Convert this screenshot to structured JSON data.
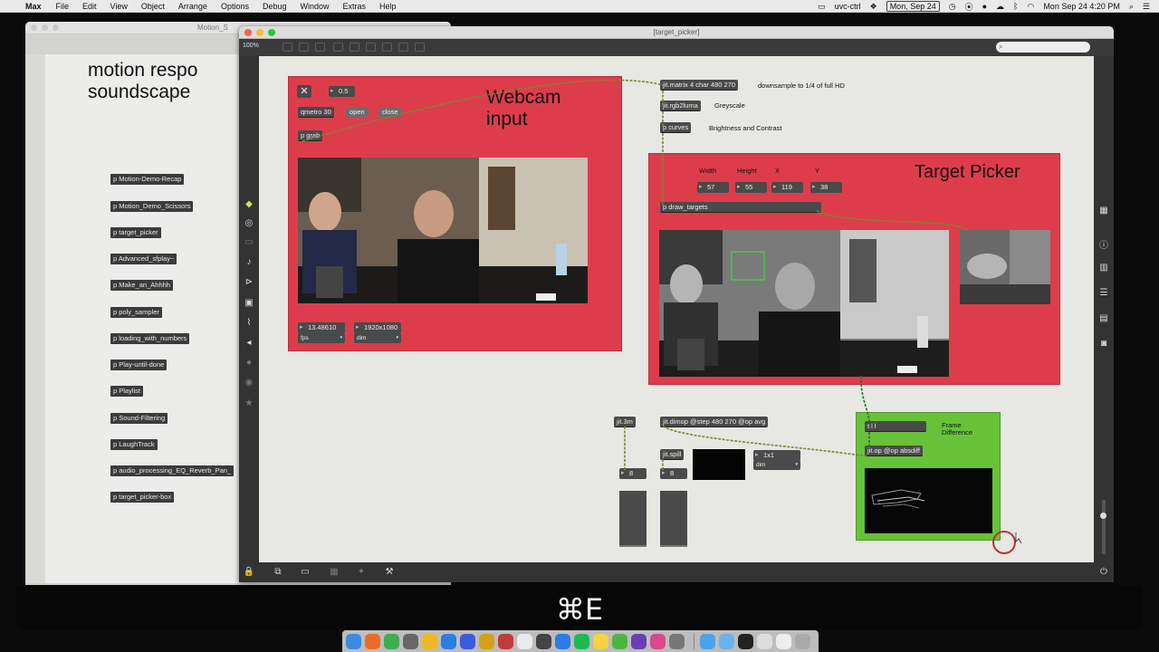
{
  "menubar": {
    "app_name": "Max",
    "items": [
      "File",
      "Edit",
      "View",
      "Object",
      "Arrange",
      "Options",
      "Debug",
      "Window",
      "Extras",
      "Help"
    ],
    "status": {
      "uvc": "uvc-ctrl",
      "date_box": "Mon, Sep 24",
      "clock": "Mon Sep 24  4:20 PM"
    }
  },
  "back_window": {
    "title": "Motion_S",
    "heading": "motion respo\nsoundscape",
    "subpatchers": [
      "p Motion-Demo-Recap",
      "p Motion_Demo_Scissors",
      "p target_picker",
      "p Advanced_sfplay~",
      "p Make_an_Ahhhh",
      "p poly_sampler",
      "p loading_with_numbers",
      "p Play-until-done",
      "p Playlist",
      "p Sound-Filtering",
      "p LaughTrack",
      "p audio_processing_EQ_Reverb_Pan_",
      "p target_picker-box"
    ]
  },
  "main_window": {
    "title": "[target_picker]",
    "zoom": "100%",
    "webcam_panel": {
      "label": "Webcam\ninput",
      "close_glyph": "✕",
      "float_value": "0.5",
      "qmetro": "qmetro 30",
      "open": "open",
      "close": "close",
      "grab": "p grab",
      "fps_value": "13.48610",
      "fps_label": "fps",
      "dim_value": "1920x1080",
      "dim_label": "dim"
    },
    "pipeline": [
      {
        "object": "jit.matrix 4 char 480 270",
        "comment": "downsample to 1/4 of full HD"
      },
      {
        "object": "jit.rgb2luma",
        "comment": "Greyscale"
      },
      {
        "object": "p curves",
        "comment": "Brightness and Contrast"
      }
    ],
    "target_panel": {
      "label": "Target Picker",
      "headers": [
        "Width",
        "Height",
        "X",
        "Y"
      ],
      "values": [
        "57",
        "55",
        "119",
        "38"
      ],
      "draw_targets": "p draw_targets"
    },
    "diff_section": {
      "jit3m": "jit.3m",
      "dimop": "jit.dimop @step 480 270 @op avg",
      "spill": "jit.spill",
      "num_left": "8",
      "num_right": "8",
      "dim_value": "1x1",
      "dim_label": "dim"
    },
    "frame_diff_panel": {
      "trigger": "t l l",
      "label": "Frame\nDifference",
      "op": "jit.op @op absdiff"
    }
  },
  "overlay": {
    "shortcut": "⌘E"
  },
  "colors": {
    "red_panel": "#dd3d4a",
    "green_panel": "#67c23a",
    "patch_cord": "#7a8c3a",
    "cursor_ring": "#c0303a"
  }
}
